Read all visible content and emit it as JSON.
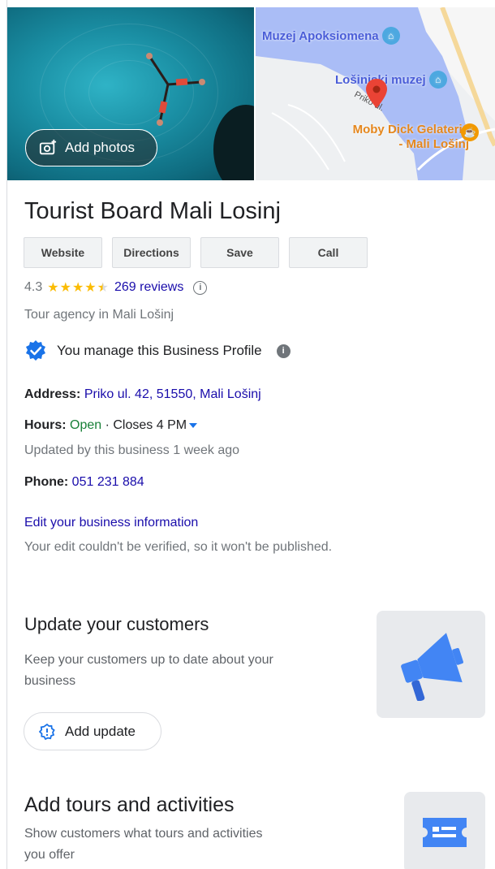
{
  "header": {
    "add_photos_label": "Add photos",
    "map": {
      "poi_museum1": "Muzej Apoksiomena",
      "poi_museum2": "Lošinjski muzej",
      "poi_food": "Moby Dick Gelateria\n- Mali Lošinj",
      "road": "Priko ul."
    }
  },
  "business": {
    "name": "Tourist Board Mali Losinj",
    "buttons": [
      "Website",
      "Directions",
      "Save",
      "Call"
    ],
    "rating": "4.3",
    "stars": 4.3,
    "reviews": "269 reviews",
    "category": "Tour agency in Mali Lošinj",
    "manage_text": "You manage this Business Profile",
    "address_label": "Address:",
    "address": "Priko ul. 42, 51550, Mali Lošinj",
    "hours_label": "Hours:",
    "hours_status": "Open",
    "hours_sep": " · ",
    "hours_closes": "Closes 4 PM",
    "hours_updated": "Updated by this business 1 week ago",
    "phone_label": "Phone:",
    "phone": "051 231 884",
    "edit_link": "Edit your business information",
    "edit_note": "Your edit couldn't be verified, so it won't be published."
  },
  "updates": {
    "title": "Update your customers",
    "desc_line1": "Keep your customers up to date about your",
    "desc_line2": "business",
    "button": "Add update"
  },
  "tours": {
    "title": "Add tours and activities",
    "desc_line1": "Show customers what tours and activities",
    "desc_line2": "you offer"
  },
  "colors": {
    "link": "#1a0dab",
    "open": "#188038",
    "star": "#fbbc04",
    "accent_blue": "#4285f4"
  }
}
